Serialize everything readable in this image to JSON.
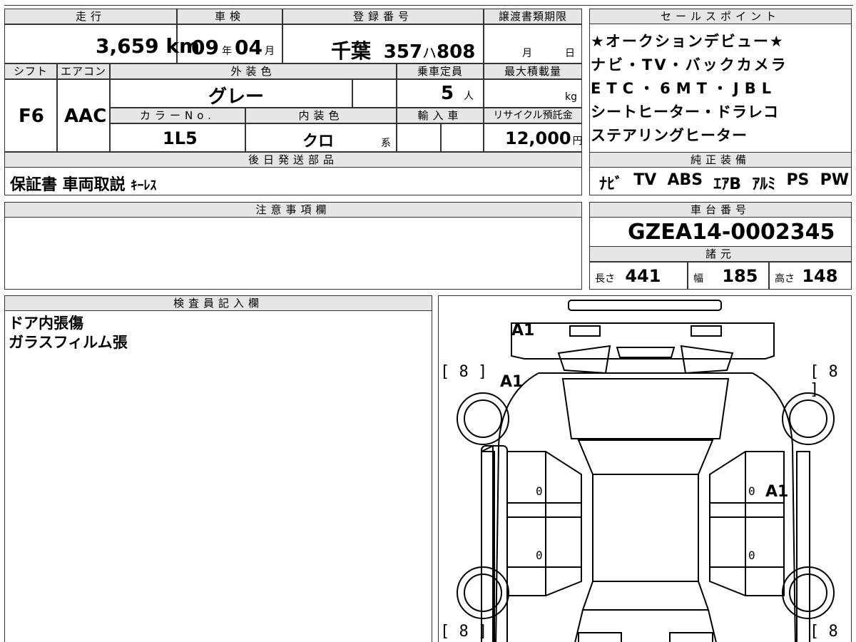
{
  "labels": {
    "mileage": "走行",
    "inspection": "車検",
    "registration": "登録番号",
    "transfer_deadline": "譲渡書類期限",
    "sales_points": "セールスポイント",
    "shift": "シフト",
    "aircon": "エアコン",
    "exterior_color": "外装色",
    "capacity": "乗車定員",
    "max_load": "最大積載量",
    "color_no": "カラーNo.",
    "interior_color": "内装色",
    "import": "輸入車",
    "recycle_deposit": "リサイクル預託金",
    "later_parts": "後日発送部品",
    "factory_equipment": "純正装備",
    "notes": "注意事項欄",
    "chassis_no": "車台番号",
    "specs": "諸元",
    "inspector_notes": "検査員記入欄",
    "length": "長さ",
    "width": "幅",
    "height": "高さ"
  },
  "vehicle": {
    "mileage_value": "3,659",
    "mileage_unit": "km",
    "inspection_year": "09",
    "year_unit": "年",
    "inspection_month": "04",
    "month_unit": "月",
    "plate_region": "千葉",
    "plate_class": "357",
    "plate_kana": "ハ",
    "plate_number": "808",
    "deadline_month": "月",
    "deadline_day": "日",
    "shift_value": "F6",
    "aircon_value": "AAC",
    "exterior_color_value": "グレー",
    "capacity_value": "5",
    "capacity_unit": "人",
    "max_load_unit": "kg",
    "color_no_value": "1L5",
    "interior_color_value": "クロ",
    "interior_color_unit": "系",
    "recycle_value": "12,000",
    "recycle_unit": "円",
    "later_parts_value": "保証書 車両取説",
    "later_parts_small": "ｷｰﾚｽ",
    "chassis_value": "GZEA14-0002345",
    "length_value": "441",
    "width_value": "185",
    "height_value": "148"
  },
  "sales_points": [
    "★オークションデビュー★",
    "ナビ・TV・バックカメラ",
    "ETC・6MT・JBL",
    "シートヒーター・ドラレコ",
    "ステアリングヒーター"
  ],
  "equipment": [
    "ﾅﾋﾞ",
    "TV",
    "ABS",
    "ｴｱB",
    "ｱﾙﾐ",
    "PS",
    "PW"
  ],
  "inspector_lines": [
    "ドア内張傷",
    "ガラスフィルム張"
  ],
  "diagram": {
    "grade_front": "A1",
    "grade_front_left": "A1",
    "grade_right_door": "A1",
    "tire_tl": "[ 8 ]",
    "tire_tr": "[ 8 ]",
    "tire_bl": "[ 8 ]",
    "tire_br": "[ 8 ]",
    "zero": "0"
  }
}
